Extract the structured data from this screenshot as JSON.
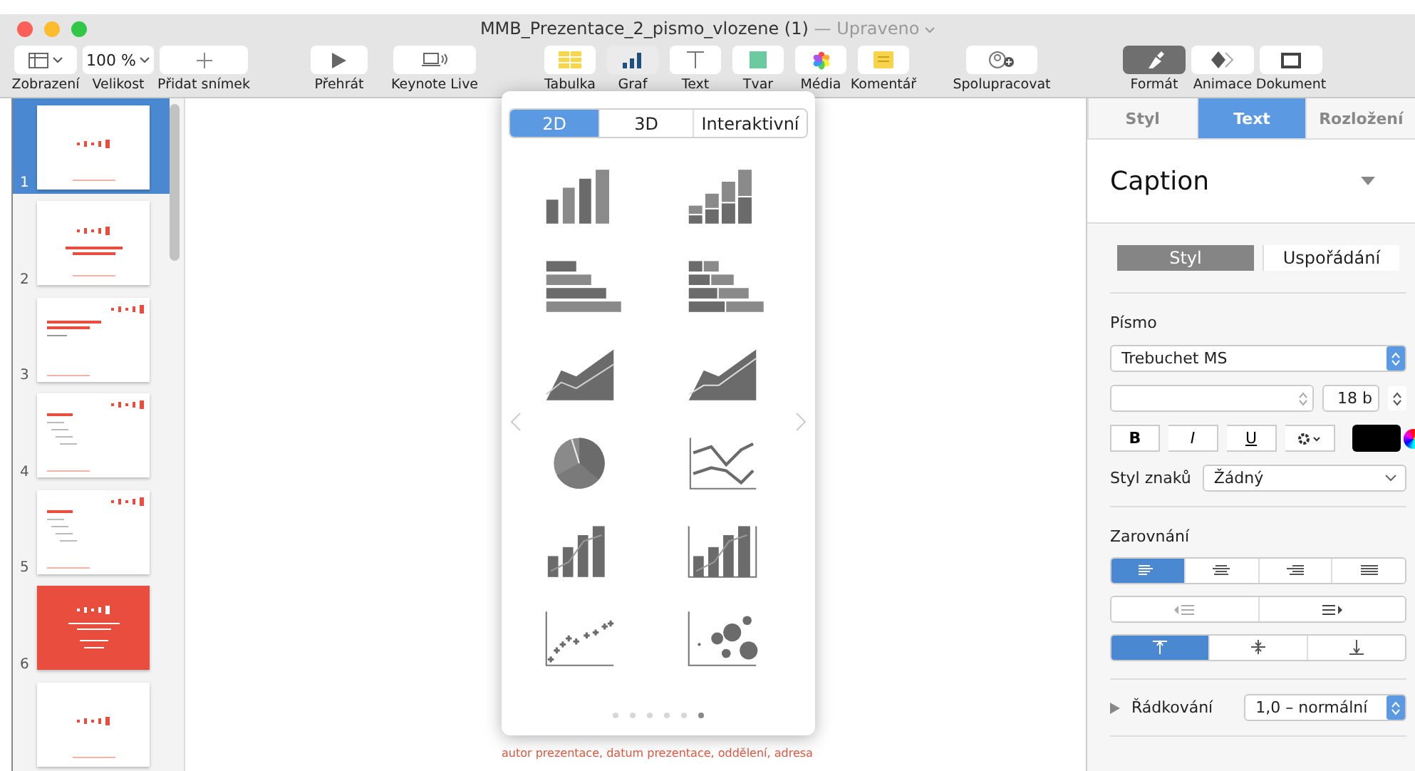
{
  "window": {
    "title": "MMB_Prezentace_2_pismo_vlozene (1)",
    "separator": "—",
    "status": "Upraveno"
  },
  "toolbar": {
    "groups": [
      [
        {
          "label": "Zobrazení",
          "selected": false
        },
        {
          "label": "Velikost",
          "value": "100 %",
          "selected": false
        },
        {
          "label": "Přidat snímek",
          "selected": false
        }
      ],
      [
        {
          "label": "Přehrát",
          "selected": false
        },
        {
          "label": "Keynote Live",
          "selected": false
        }
      ],
      [
        {
          "label": "Tabulka",
          "selected": false
        },
        {
          "label": "Graf",
          "selected": true
        },
        {
          "label": "Text",
          "selected": false
        },
        {
          "label": "Tvar",
          "selected": false
        },
        {
          "label": "Média",
          "selected": false
        },
        {
          "label": "Komentář",
          "selected": false
        }
      ],
      [
        {
          "label": "Spolupracovat",
          "selected": false
        }
      ],
      [
        {
          "label": "Formát",
          "selected": true
        },
        {
          "label": "Animace",
          "selected": false
        },
        {
          "label": "Dokument",
          "selected": false
        }
      ]
    ]
  },
  "slides": [
    {
      "number": "1",
      "selected": true,
      "kind": "logo"
    },
    {
      "number": "2",
      "selected": false,
      "kind": "title"
    },
    {
      "number": "3",
      "selected": false,
      "kind": "heading"
    },
    {
      "number": "4",
      "selected": false,
      "kind": "list"
    },
    {
      "number": "5",
      "selected": false,
      "kind": "list"
    },
    {
      "number": "6",
      "selected": false,
      "kind": "accent"
    },
    {
      "selected": false,
      "kind": "logo"
    }
  ],
  "canvas": {
    "footer": "autor prezentace, datum prezentace, oddělení, adresa"
  },
  "chart_popover": {
    "tabs": [
      {
        "label": "2D",
        "selected": true
      },
      {
        "label": "3D",
        "selected": false
      },
      {
        "label": "Interaktivní",
        "selected": false
      }
    ],
    "pages": [
      {
        "selected": false
      },
      {
        "selected": false
      },
      {
        "selected": false
      },
      {
        "selected": false
      },
      {
        "selected": false
      },
      {
        "selected": true
      }
    ]
  },
  "inspector": {
    "tabs": [
      {
        "label": "Styl",
        "selected": false
      },
      {
        "label": "Text",
        "selected": true
      },
      {
        "label": "Rozložení",
        "selected": false
      }
    ],
    "paragraph_style": "Caption",
    "segments": [
      {
        "label": "Styl",
        "selected": true
      },
      {
        "label": "Uspořádání",
        "selected": false
      }
    ],
    "font_label": "Písmo",
    "font": "Trebuchet MS",
    "size": "18 b",
    "format_buttons": [
      {
        "label": "B"
      },
      {
        "label": "I"
      },
      {
        "label": "U"
      }
    ],
    "char_style_label": "Styl znaků",
    "char_style": "Žádný",
    "alignment_label": "Zarovnání",
    "horizontal_align": [
      {
        "selected": true
      },
      {
        "selected": false
      },
      {
        "selected": false
      },
      {
        "selected": false
      }
    ],
    "vertical_align": [
      {
        "selected": true
      },
      {
        "selected": false
      },
      {
        "selected": false
      }
    ],
    "spacing_label": "Řádkování",
    "spacing": "1,0 – normální"
  }
}
